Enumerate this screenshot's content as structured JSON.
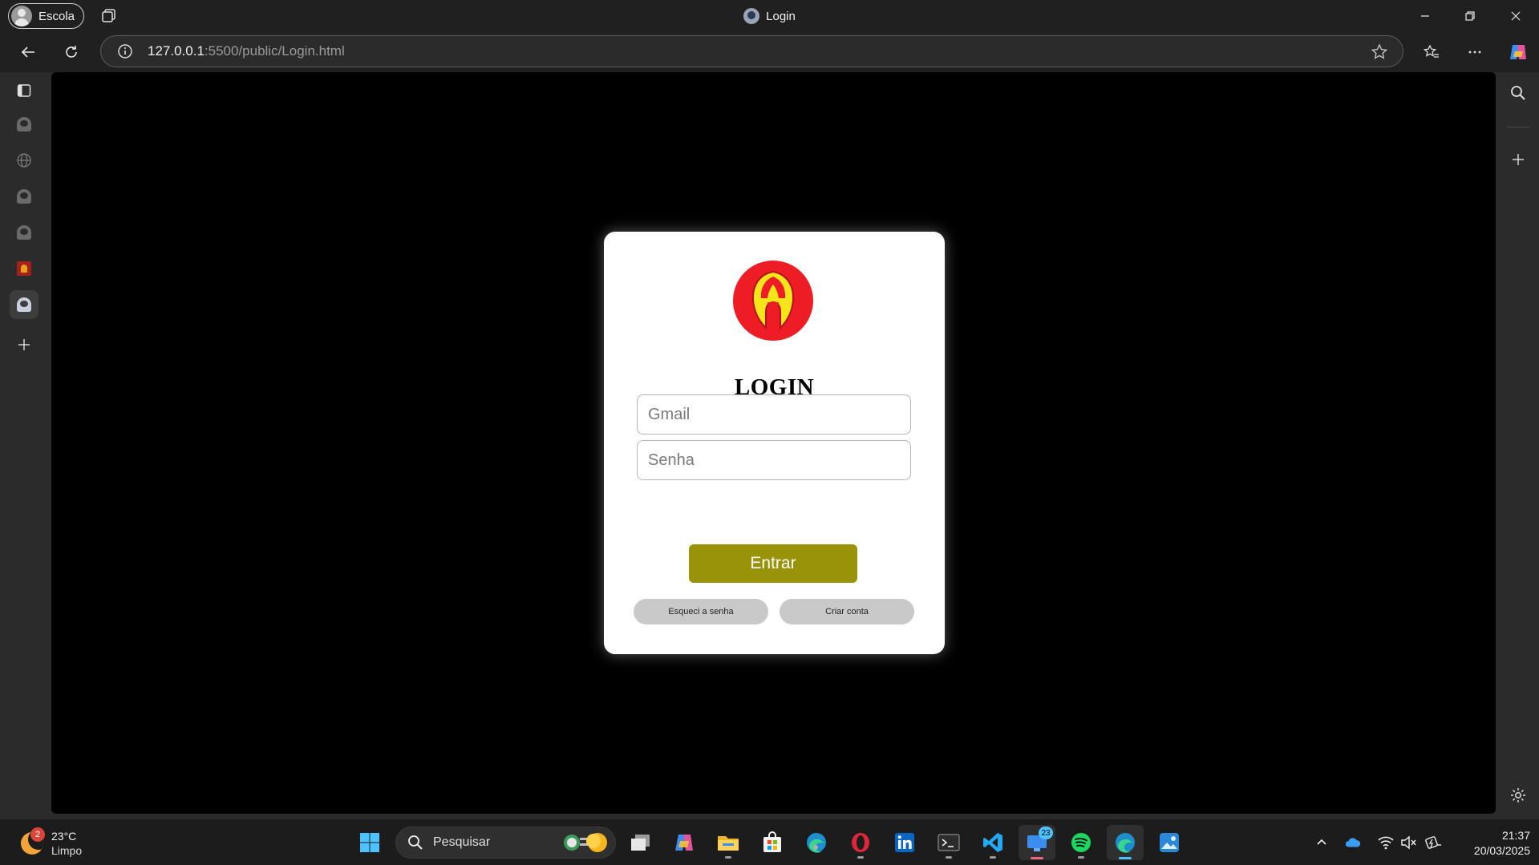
{
  "browser": {
    "profile_label": "Escola",
    "tab_title": "Login",
    "address": {
      "host": "127.0.0.1",
      "rest": ":5500/public/Login.html"
    }
  },
  "page": {
    "heading": "LOGIN",
    "email_placeholder": "Gmail",
    "password_placeholder": "Senha",
    "submit_label": "Entrar",
    "forgot_label": "Esqueci a senha",
    "create_label": "Criar conta",
    "colors": {
      "submit_bg": "#999309",
      "secondary_bg": "#c9c9c9",
      "logo_red": "#ee1c25",
      "logo_yellow": "#f7e51b"
    }
  },
  "taskbar": {
    "weather_temp": "23°C",
    "weather_condition": "Limpo",
    "weather_badge": "2",
    "search_label": "Pesquisar",
    "app_badge": "23",
    "time": "21:37",
    "date": "20/03/2025"
  },
  "icons": {
    "sidebar": [
      "sidebar-toggle-icon",
      "profile-icon",
      "globe-icon",
      "profile-icon",
      "profile-icon",
      "app-tile-icon",
      "active-profile-icon",
      "add-icon"
    ],
    "taskbar": [
      "windows-start-icon",
      "search-icon",
      "task-view-icon",
      "copilot-icon",
      "file-explorer-icon",
      "store-icon",
      "edge-dev-icon",
      "opera-icon",
      "linkedin-icon",
      "terminal-icon",
      "vscode-icon",
      "remote-desktop-icon",
      "spotify-icon",
      "edge-icon",
      "photos-icon"
    ]
  }
}
